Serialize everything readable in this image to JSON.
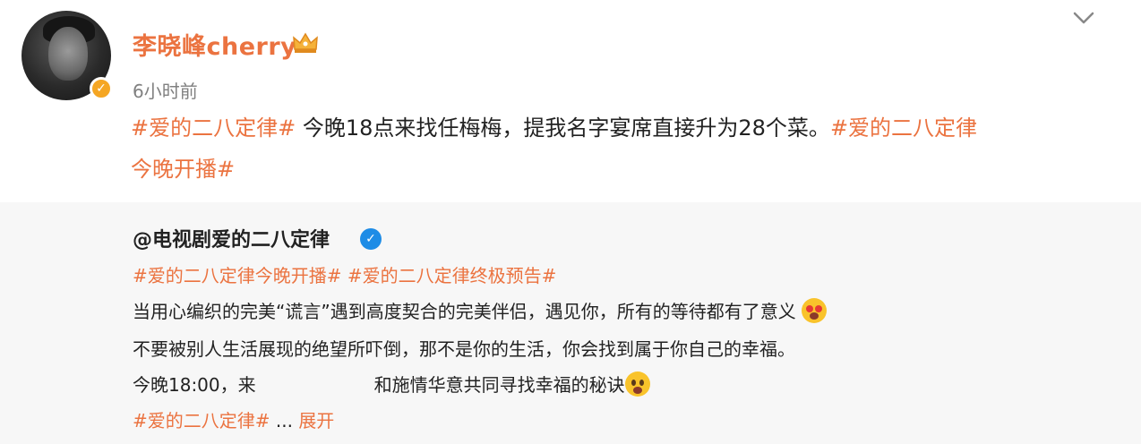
{
  "post": {
    "username": "李晓峰cherry",
    "time": "6小时前",
    "tag1": "#爱的二八定律#",
    "body": " 今晚18点来找任梅梅，提我名字宴席直接升为28个菜。",
    "tag2": "#爱的二八定律",
    "tag3": "今晚开播#"
  },
  "repost": {
    "user": "@电视剧爱的二八定律",
    "tags": "#爱的二八定律今晚开播# #爱的二八定律终极预告#",
    "line1": "当用心编织的完美“谎言”遇到高度契合的完美伴侣，遇见你，所有的等待都有了意义",
    "line2": "不要被别人生活展现的绝望所吓倒，那不是你的生活，你会找到属于你自己的幸福。",
    "line3a": "今晚18:00，来",
    "line3b": "和施情华意共同寻找幸福的秘诀",
    "tag_bottom": "#爱的二八定律#",
    "ellipsis": "...",
    "expand": "展开"
  },
  "icons": {
    "verify": "orange-verified-badge",
    "crown": "crown-icon",
    "chevron": "chevron-down-icon",
    "blue_verify": "blue-verified-badge",
    "emoji1": "heart-eyes-emoji",
    "emoji2": "shocked-emoji"
  },
  "colors": {
    "accent": "#eb7340",
    "blue": "#1e8ce6",
    "repost_bg": "#f7f7f7"
  }
}
